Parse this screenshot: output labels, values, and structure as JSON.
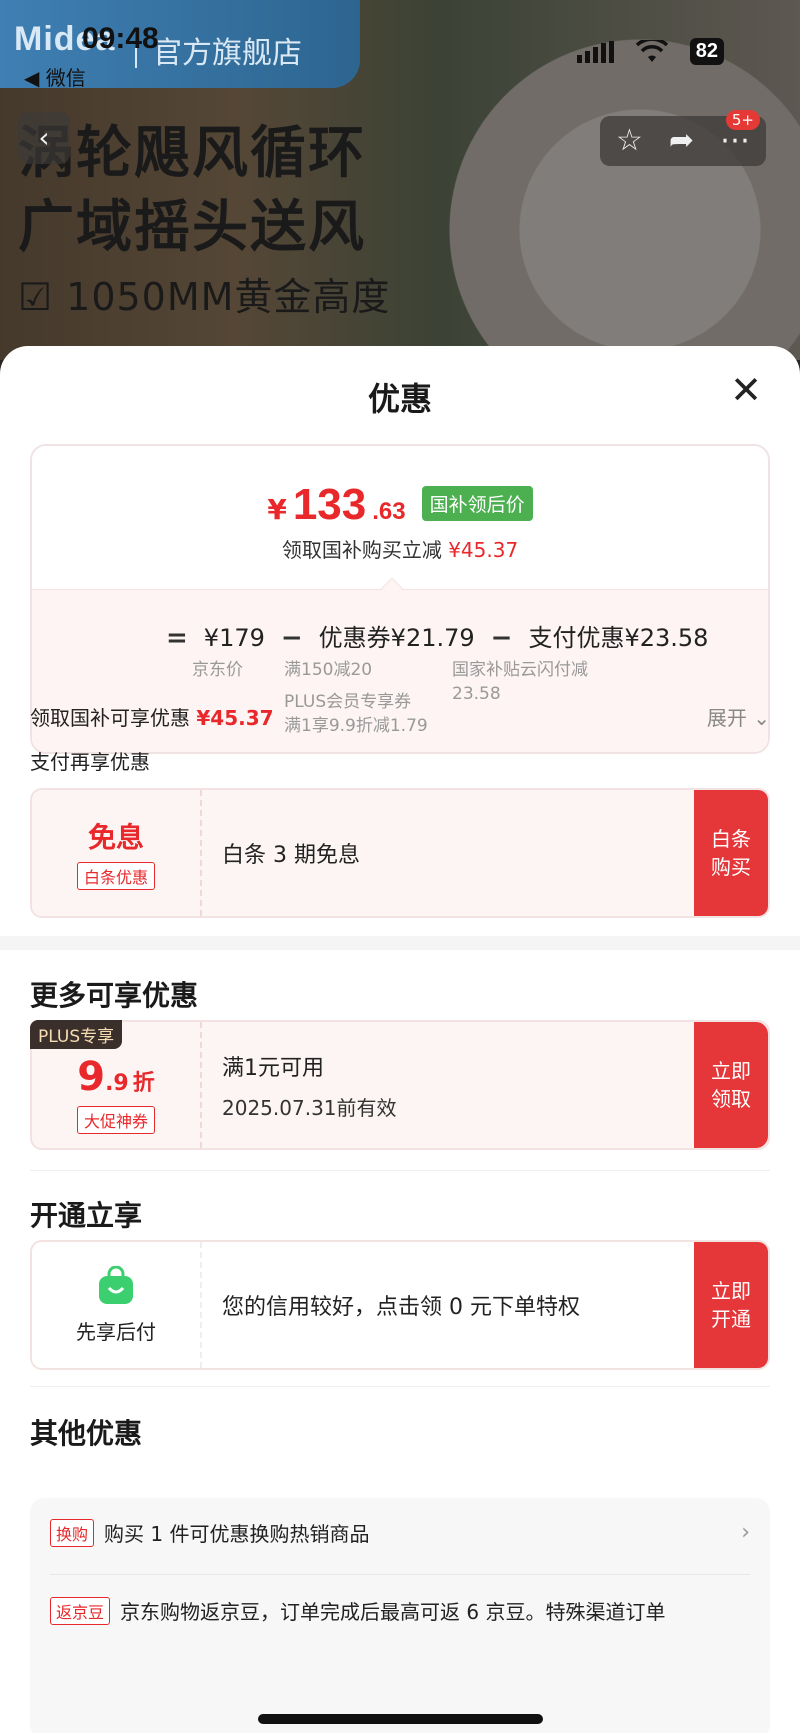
{
  "status_bar": {
    "time": "09:48",
    "back_app": "◀ 微信",
    "battery": "82"
  },
  "store": {
    "logo": "Midea",
    "name": "官方旗舰店"
  },
  "hero": {
    "line1": "涡轮飓风循环",
    "line2": "广域摇头送风",
    "line3": "☑ 1050MM黄金高度"
  },
  "top_actions": {
    "badge": "5+",
    "star_icon": "star-icon",
    "share_icon": "share-icon",
    "more_icon": "more-icon"
  },
  "sheet": {
    "title": "优惠",
    "close": "✕"
  },
  "price_card": {
    "yen": "¥",
    "price_int": "133",
    "price_dec": ".63",
    "tag": "国补领后价",
    "subtitle_prefix": "领取国补购买立减",
    "subtitle_amount": "¥45.37",
    "calc": {
      "eq": "=",
      "jd_price": "¥179",
      "minus1": "−",
      "coupon": "优惠券¥21.79",
      "minus2": "−",
      "pay": "支付优惠¥23.58",
      "jd_price_label": "京东价",
      "coupon_note1": "满150减20",
      "coupon_note2": "PLUS会员专享券",
      "coupon_note3": "满1享9.9折减1.79",
      "pay_note1": "国家补贴云闪付减",
      "pay_note2": "23.58"
    }
  },
  "subsidy_row": {
    "label": "领取国补可享优惠",
    "amount": "¥45.37",
    "expand": "展开 ⌄"
  },
  "pay_section": {
    "title": "支付再享优惠",
    "card": {
      "left_big": "免息",
      "left_chip": "白条优惠",
      "mid_text": "白条 3 期免息",
      "btn_line1": "白条",
      "btn_line2": "购买"
    }
  },
  "more_section": {
    "title": "更多可享优惠",
    "plus_tag": "PLUS专享",
    "discount_big": "9",
    "discount_small": ".9",
    "discount_unit": "折",
    "chip": "大促神券",
    "line1": "满1元可用",
    "line2": "2025.07.31前有效",
    "btn_line1": "立即",
    "btn_line2": "领取"
  },
  "open_section": {
    "title": "开通立享",
    "left_label": "先享后付",
    "mid_text": "您的信用较好，点击领 0 元下单特权",
    "btn_line1": "立即",
    "btn_line2": "开通"
  },
  "other_section": {
    "title": "其他优惠",
    "items": [
      {
        "tag": "换购",
        "text": "购买 1 件可优惠换购热销商品"
      },
      {
        "tag": "返京豆",
        "text": "京东购物返京豆，订单完成后最高可返 6 京豆。特殊渠道订单"
      }
    ]
  },
  "colors": {
    "accent_red": "#e5373a",
    "green_tag": "#4caf50"
  }
}
